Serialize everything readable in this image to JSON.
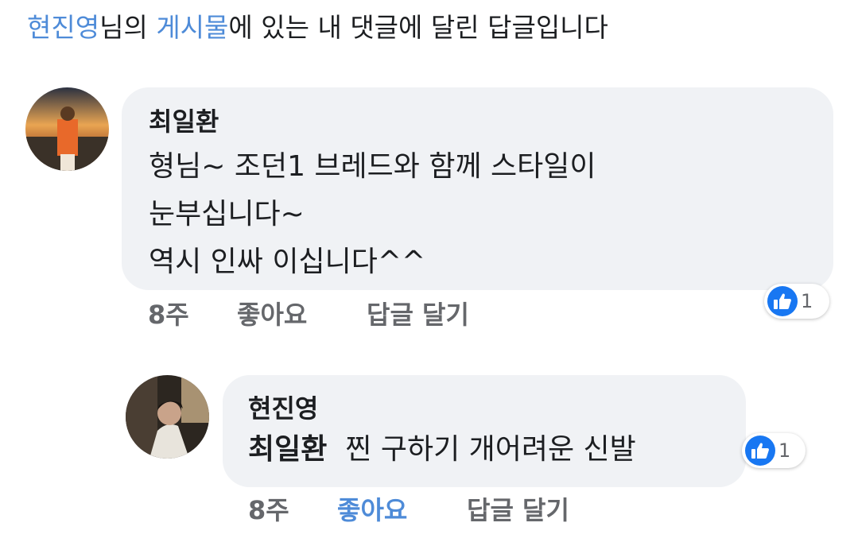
{
  "header": {
    "user_link": "현진영",
    "text1": "님의 ",
    "post_link": "게시물",
    "text2": "에 있는 내 댓글에 달린 답글입니다"
  },
  "comments": [
    {
      "author": "최일환",
      "lines": [
        "형님~ 조던1 브레드와 함께 스타일이",
        "눈부십니다~",
        "역시 인싸 이십니다^^"
      ],
      "time": "8주",
      "like_label": "좋아요",
      "reply_label": "답글 달기",
      "reaction_count": "1"
    },
    {
      "author": "현진영",
      "tag": "최일환",
      "text": "찐 구하기 개어려운 신발",
      "time": "8주",
      "like_label": "좋아요",
      "reply_label": "답글 달기",
      "reaction_count": "1"
    }
  ],
  "colors": {
    "link": "#4e8bd8",
    "bubble": "#f0f2f5",
    "meta": "#65676b",
    "like_blue": "#1877f2"
  },
  "icons": [
    "like-icon"
  ]
}
